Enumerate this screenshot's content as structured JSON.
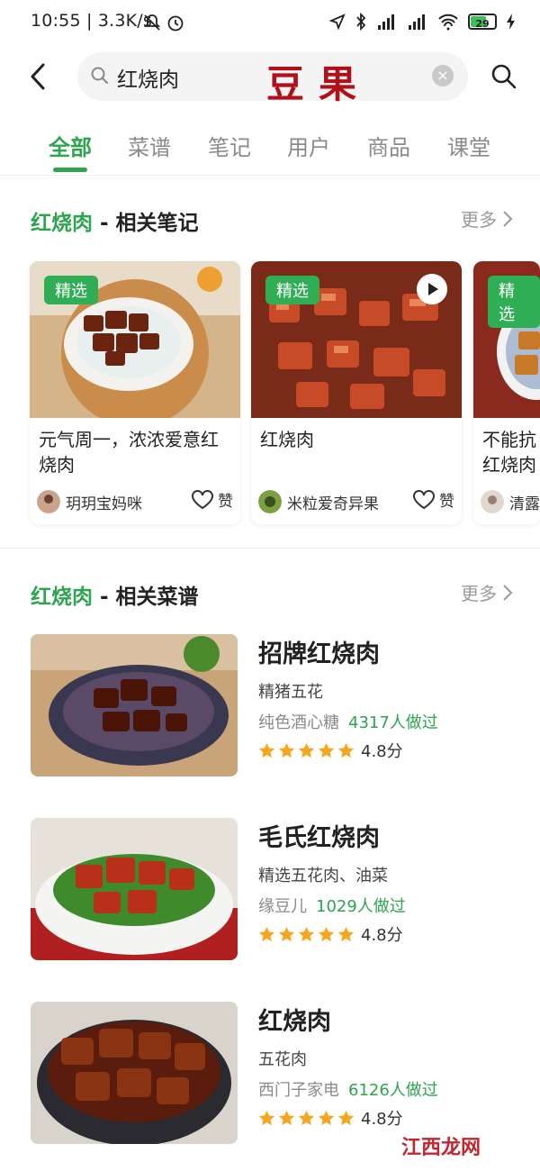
{
  "status_bar": {
    "time_speed": "10:55 | 3.3K/s",
    "battery": "29"
  },
  "search": {
    "query": "红烧肉",
    "brand": "豆果"
  },
  "tabs": [
    "全部",
    "菜谱",
    "笔记",
    "用户",
    "商品",
    "课堂"
  ],
  "notes_section": {
    "keyword": "红烧肉",
    "title": " - 相关笔记",
    "more": "更多"
  },
  "notes": [
    {
      "badge": "精选",
      "title": "元气周一，浓浓爱意红烧肉",
      "author": "玥玥宝妈咪",
      "like": "赞"
    },
    {
      "badge": "精选",
      "title": "红烧肉",
      "author": "米粒爱奇异果",
      "like": "赞"
    },
    {
      "badge": "精选",
      "title": "不能抗红烧肉",
      "author": "清露"
    }
  ],
  "recipes_section": {
    "keyword": "红烧肉",
    "title": " - 相关菜谱",
    "more": "更多"
  },
  "recipes": [
    {
      "name": "招牌红烧肉",
      "ingredients": "精猪五花",
      "author": "纯色酒心糖",
      "count": "4317人做过",
      "rating": "4.8分"
    },
    {
      "name": "毛氏红烧肉",
      "ingredients": "精选五花肉、油菜",
      "author": "缘豆儿",
      "count": "1029人做过",
      "rating": "4.8分"
    },
    {
      "name": "红烧肉",
      "ingredients": "五花肉",
      "author": "西门子家电",
      "count": "6126人做过",
      "rating": "4.8分"
    }
  ],
  "watermark": "江西龙网"
}
